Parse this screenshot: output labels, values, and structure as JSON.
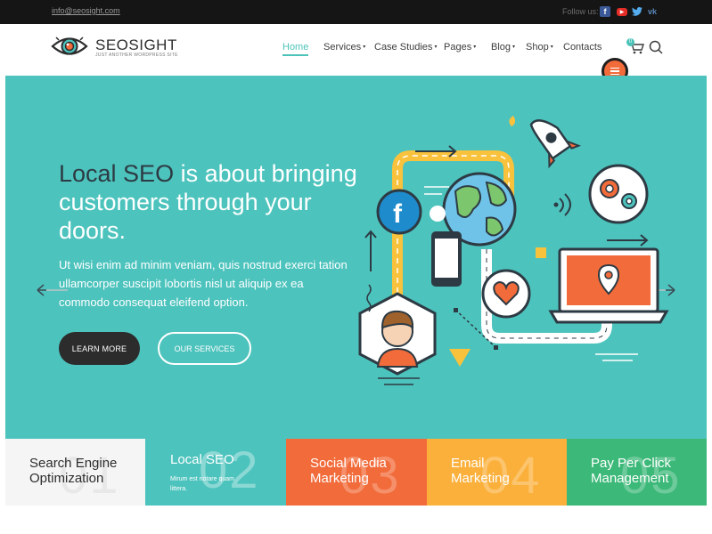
{
  "topbar": {
    "email": "info@seosight.com",
    "follow_label": "Follow us:",
    "social": [
      {
        "icon": "facebook-icon",
        "glyph": "f"
      },
      {
        "icon": "youtube-icon",
        "glyph": "▶"
      },
      {
        "icon": "twitter-icon",
        "glyph": "🐦"
      },
      {
        "icon": "vk-icon",
        "glyph": "vk"
      }
    ]
  },
  "header": {
    "logo_title": "SEOSIGHT",
    "logo_subtitle": "JUST ANOTHER WORDPRESS SITE",
    "nav": {
      "home": "Home",
      "services": "Services",
      "case_studies": "Case Studies",
      "pages": "Pages",
      "blog": "Blog",
      "shop": "Shop",
      "contacts": "Contacts"
    },
    "cart_count": "0"
  },
  "hero": {
    "headline_1": "Local SEO",
    "headline_2": " is about bringing customers through your doors.",
    "subtext": "Ut wisi enim ad minim veniam, quis nostrud exerci tation ullamcorper suscipit lobortis nisl ut aliquip ex ea commodo consequat eleifend option.",
    "learn_more": "LEARN MORE",
    "our_services": "OUR SERVICES"
  },
  "tiles": [
    {
      "num": "01",
      "label": "Search Engine Optimization",
      "color": "#f5f5f5"
    },
    {
      "num": "02",
      "label": "Local SEO",
      "small": "Mirum est notare quam littera.",
      "color": "#4dc3bd"
    },
    {
      "num": "03",
      "label": "Social Media Marketing",
      "color": "#f26b3a"
    },
    {
      "num": "04",
      "label": "Email Marketing",
      "color": "#fbb03b"
    },
    {
      "num": "05",
      "label": "Pay Per Click Management",
      "color": "#3cb878"
    }
  ],
  "colors": {
    "accent": "#4cc3b8",
    "hero_bg": "#4dc3bd",
    "orange": "#f26b3a",
    "yellow": "#fbb03b",
    "green": "#3cb878",
    "topbar": "#151515"
  }
}
